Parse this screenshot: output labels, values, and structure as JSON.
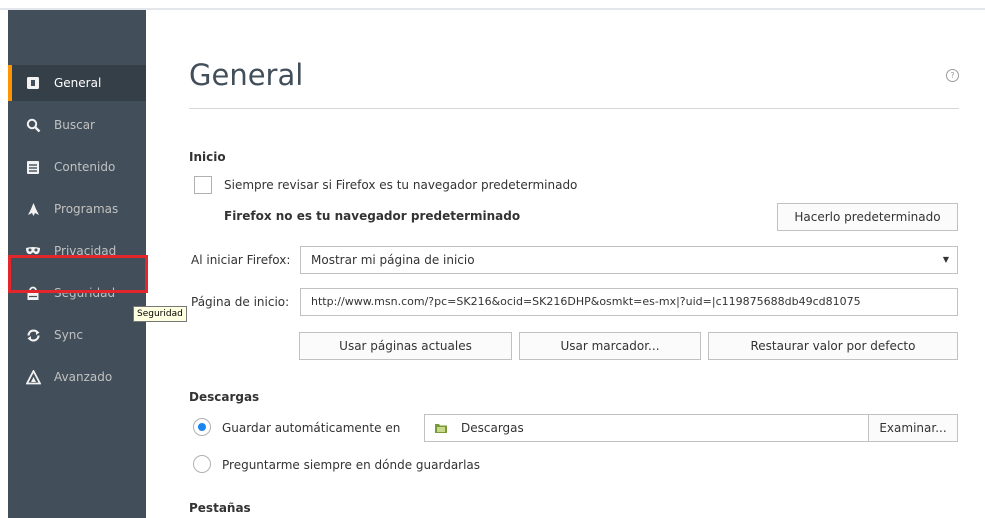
{
  "sidebar": {
    "items": [
      {
        "label": "General",
        "icon": "general-icon",
        "selected": true
      },
      {
        "label": "Buscar",
        "icon": "search-icon",
        "selected": false
      },
      {
        "label": "Contenido",
        "icon": "content-icon",
        "selected": false
      },
      {
        "label": "Programas",
        "icon": "applications-icon",
        "selected": false
      },
      {
        "label": "Privacidad",
        "icon": "privacy-mask-icon",
        "selected": false
      },
      {
        "label": "Seguridad",
        "icon": "lock-icon",
        "selected": false
      },
      {
        "label": "Sync",
        "icon": "sync-icon",
        "selected": false
      },
      {
        "label": "Avanzado",
        "icon": "advanced-icon",
        "selected": false
      }
    ],
    "tooltip": "Seguridad"
  },
  "colors": {
    "sidebar_bg": "#424f5a",
    "selected_accent": "#ff9500",
    "highlight_red": "#e3262b",
    "radio_blue": "#1a84f0"
  },
  "main": {
    "title": "General",
    "help_icon": "?",
    "startup": {
      "section_title": "Inicio",
      "check_default_label": "Siempre revisar si Firefox es tu navegador predeterminado",
      "check_default_checked": false,
      "not_default_text": "Firefox no es tu navegador predeterminado",
      "make_default_button": "Hacerlo predeterminado",
      "on_start_label": "Al iniciar Firefox:",
      "on_start_value": "Mostrar mi página de inicio",
      "homepage_label": "Página de inicio:",
      "homepage_value": "http://www.msn.com/?pc=SK216&ocid=SK216DHP&osmkt=es-mx|?uid=|c119875688db49cd81075",
      "use_current_button": "Usar páginas actuales",
      "use_bookmark_button": "Usar marcador...",
      "restore_default_button": "Restaurar valor por defecto"
    },
    "downloads": {
      "section_title": "Descargas",
      "save_to_label": "Guardar automáticamente en",
      "save_to_selected": true,
      "folder_value": "Descargas",
      "browse_button": "Examinar...",
      "always_ask_label": "Preguntarme siempre en dónde guardarlas"
    },
    "tabs": {
      "section_title": "Pestañas"
    }
  }
}
